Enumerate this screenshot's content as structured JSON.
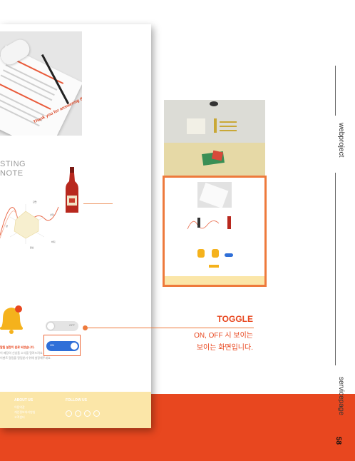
{
  "colors": {
    "accent": "#e8471f",
    "highlight": "#ee7a3c",
    "footer": "#fbe6a8",
    "toggle_on": "#2f6fd8"
  },
  "survey_photo": {
    "thanks_text": "Thank you for answering this survey."
  },
  "tasting": {
    "title_line1": "STING",
    "title_line2": "NOTE"
  },
  "chart_labels": [
    "단맛",
    "산미",
    "바디",
    "탄산",
    "향"
  ],
  "toggle_off_label": "OFF",
  "toggle_on_label": "ON",
  "alert_texts": [
    "알림 설정이 완료 되었습니다.",
    "이 매장의 신상품 소식을 알려드려요.",
    "이벤트 알림을 알림받기 위해 설정해주세요."
  ],
  "footer": {
    "about": "ABOUT US",
    "follow": "FOLLOW US",
    "links": [
      "이용약관",
      "개인정보처리방침",
      "고객센터"
    ]
  },
  "annotation": {
    "title": "TOGGLE",
    "desc_line1": "ON, OFF 시 보이는",
    "desc_line2": "보이는 화면입니다."
  },
  "side": {
    "webproject": "webproject",
    "servicepage": "servicepage",
    "page_number": "58"
  }
}
